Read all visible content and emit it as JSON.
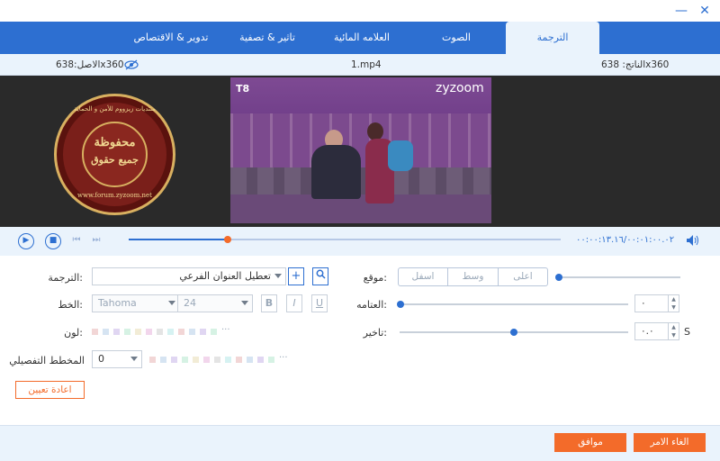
{
  "window": {
    "minimize": "—",
    "close": "✕"
  },
  "tabs": [
    {
      "label": "الترجمة"
    },
    {
      "label": "الصوت"
    },
    {
      "label": "العلامه المائية"
    },
    {
      "label": "تاثير & تصفية"
    },
    {
      "label": "تدوير & الاقتصاص"
    }
  ],
  "info": {
    "output": "الناتج: 638x360",
    "filename": "1.mp4",
    "source": "الاصل:638x360"
  },
  "video": {
    "logo": "zyzoom",
    "channel": "T8",
    "watermark_top": "منتديات زيزووم للأمن و الحماية",
    "watermark_mid": "محفوظة",
    "watermark_mid2": "جميع حقوق",
    "watermark_url": "www.forum.zyzoom.net"
  },
  "player": {
    "time": "٠٠:٠٠:١٣.١٦/٠٠:٠١:٠٠.٠٢",
    "progress": 0.23
  },
  "subtitle": {
    "label": "الترجمة:",
    "value": "تعطيل العنوان الفرعي"
  },
  "font": {
    "label": "الخط:",
    "family": "Tahoma",
    "size": "24",
    "bold": "B",
    "italic": "I",
    "underline": "U"
  },
  "color": {
    "label": "لون:"
  },
  "outline": {
    "label": "المخطط التفصيلي",
    "value": "0"
  },
  "position": {
    "label": "موقع:",
    "options": [
      "اعلى",
      "وسط",
      "اسفل"
    ]
  },
  "opacity": {
    "label": "العتامه:",
    "value": "٠",
    "level": 0
  },
  "delay": {
    "label": "تاخير:",
    "value": "٠.٠",
    "unit": "S"
  },
  "reset_label": "اعادة تعيين",
  "footer": {
    "cancel": "الغاء الامر",
    "ok": "موافق"
  },
  "swatch_colors": [
    "#f2d6d6",
    "#d6e4f2",
    "#e0d6f2",
    "#d6f2e4",
    "#f2ecd6",
    "#f2d6ec",
    "#e4e4e4",
    "#d6f2f2"
  ]
}
